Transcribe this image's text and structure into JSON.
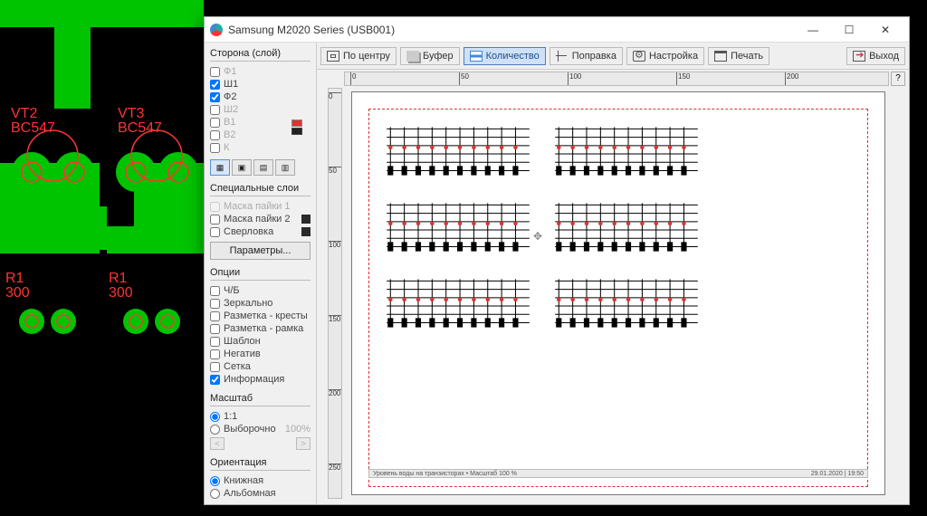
{
  "window": {
    "title": "Samsung M2020 Series (USB001)",
    "buttons": {
      "min": "—",
      "max": "☐",
      "close": "✕"
    }
  },
  "toolbar": {
    "center": "По центру",
    "buffer": "Буфер",
    "quantity": "Количество",
    "adjust": "Поправка",
    "settings": "Настройка",
    "print": "Печать",
    "exit": "Выход",
    "help": "?"
  },
  "layers": {
    "title": "Сторона (слой)",
    "items": [
      {
        "label": "Ф1",
        "checked": false
      },
      {
        "label": "Ш1",
        "checked": true
      },
      {
        "label": "Ф2",
        "checked": true
      },
      {
        "label": "Ш2",
        "checked": false
      },
      {
        "label": "В1",
        "checked": false
      },
      {
        "label": "В2",
        "checked": false
      },
      {
        "label": "К",
        "checked": false
      }
    ]
  },
  "special_layers": {
    "title": "Специальные слои",
    "mask1": "Маска пайки 1",
    "mask2": "Маска пайки 2",
    "drill": "Сверловка",
    "params_btn": "Параметры..."
  },
  "options": {
    "title": "Опции",
    "items": [
      {
        "label": "Ч/Б",
        "checked": false
      },
      {
        "label": "Зеркально",
        "checked": false
      },
      {
        "label": "Разметка - кресты",
        "checked": false
      },
      {
        "label": "Разметка - рамка",
        "checked": false
      },
      {
        "label": "Шаблон",
        "checked": false
      },
      {
        "label": "Негатив",
        "checked": false
      },
      {
        "label": "Сетка",
        "checked": false
      },
      {
        "label": "Информация",
        "checked": true
      }
    ]
  },
  "scale": {
    "title": "Масштаб",
    "opt1": "1:1",
    "opt2": "Выборочно",
    "custom_pct": "100%",
    "left": "<",
    "right": ">"
  },
  "orientation": {
    "title": "Ориентация",
    "portrait": "Книжная",
    "landscape": "Альбомная"
  },
  "ruler_h": [
    "0",
    "50",
    "100",
    "150",
    "200"
  ],
  "ruler_v": [
    "0",
    "50",
    "100",
    "150",
    "200",
    "250"
  ],
  "footer": {
    "left": "Уровень воды на транзисторах  •  Масштаб  100 %",
    "right": "29.01.2020  |  19:50"
  },
  "pcb_background": {
    "labels": {
      "vt2": "VT2",
      "vt3": "VT3",
      "bc547a": "BC547",
      "bc547b": "BC547",
      "r1": "R1",
      "r1v": "300",
      "r2": "R1",
      "r2v": "300"
    }
  }
}
